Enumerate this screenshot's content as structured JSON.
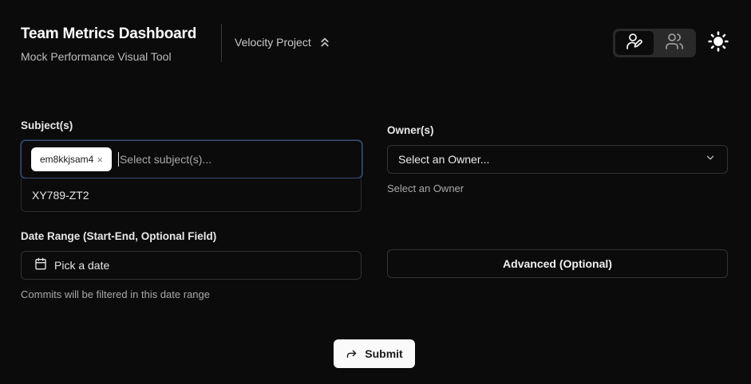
{
  "header": {
    "title": "Team Metrics Dashboard",
    "subtitle": "Mock Performance Visual Tool",
    "project_name": "Velocity Project",
    "project_icon": "chevrons-up-icon",
    "view_toggle": [
      {
        "icon": "user-pen-icon",
        "active": true
      },
      {
        "icon": "users-icon",
        "active": false
      }
    ],
    "theme_icon": "sun-icon"
  },
  "form": {
    "subjects": {
      "label": "Subject(s)",
      "selected_chip": "em8kkjsam4",
      "chip_remove": "×",
      "placeholder": "Select subject(s)...",
      "options": [
        "XY789-ZT2"
      ]
    },
    "owners": {
      "label": "Owner(s)",
      "value": "Select an Owner...",
      "helper": "Select an Owner"
    },
    "date_range": {
      "label": "Date Range (Start-End, Optional Field)",
      "button": "Pick a date",
      "helper": "Commits will be filtered in this date range"
    },
    "advanced": {
      "label": "Advanced (Optional)"
    },
    "submit": {
      "label": "Submit"
    }
  },
  "colors": {
    "background": "#0b0b0b",
    "focus_ring": "#3b4f72",
    "primary_button": "#fafafa"
  }
}
